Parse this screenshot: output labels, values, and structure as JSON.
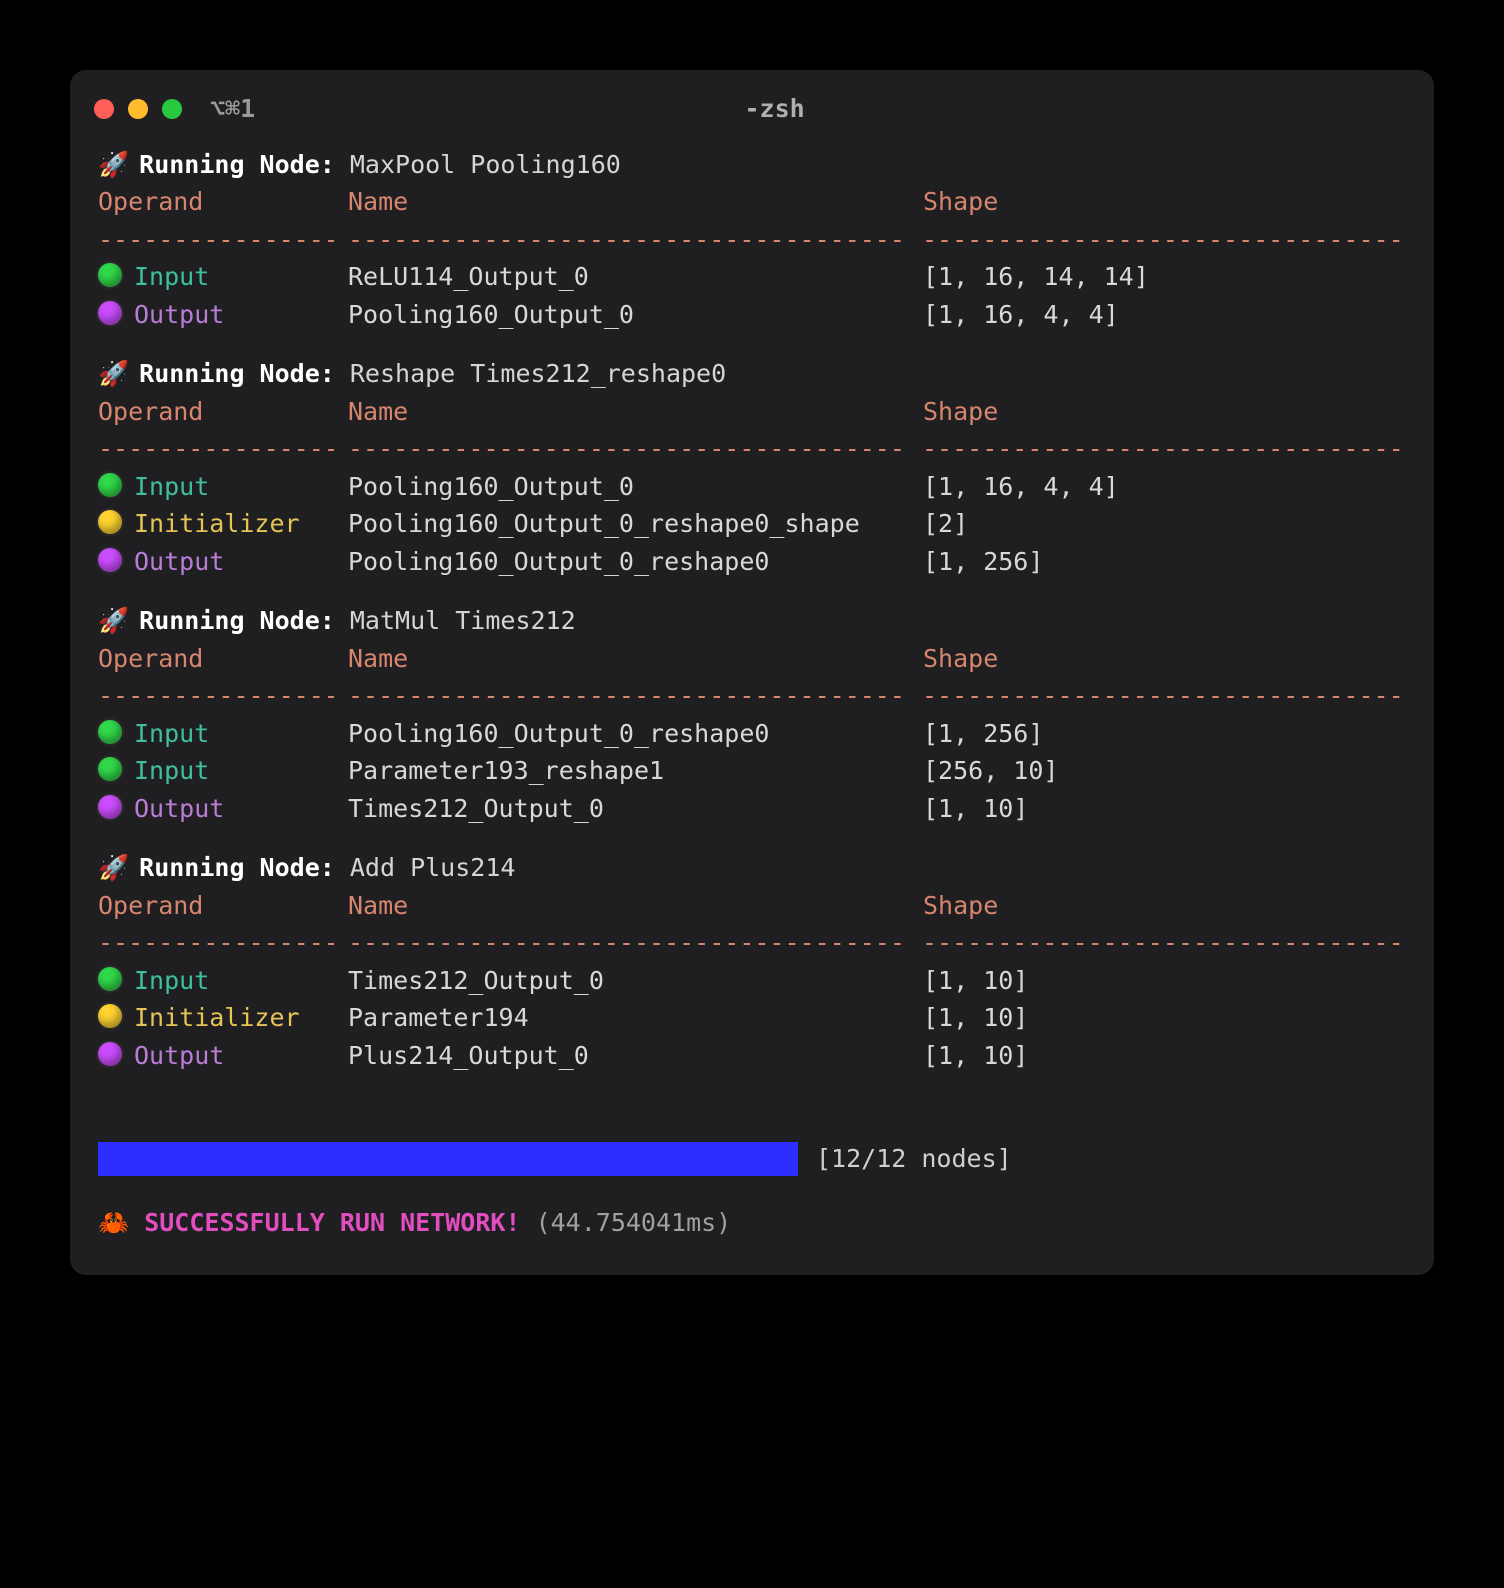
{
  "window": {
    "tab_label": "⌥⌘1",
    "title": "-zsh"
  },
  "headers": {
    "operand": "Operand",
    "name": "Name",
    "shape": "Shape"
  },
  "running_label": "Running Node:",
  "nodes": [
    {
      "title": "MaxPool Pooling160",
      "rows": [
        {
          "kind": "Input",
          "name": "ReLU114_Output_0",
          "shape": "[1, 16, 14, 14]"
        },
        {
          "kind": "Output",
          "name": "Pooling160_Output_0",
          "shape": "[1, 16, 4, 4]"
        }
      ]
    },
    {
      "title": "Reshape Times212_reshape0",
      "rows": [
        {
          "kind": "Input",
          "name": "Pooling160_Output_0",
          "shape": "[1, 16, 4, 4]"
        },
        {
          "kind": "Initializer",
          "name": "Pooling160_Output_0_reshape0_shape",
          "shape": "[2]"
        },
        {
          "kind": "Output",
          "name": "Pooling160_Output_0_reshape0",
          "shape": "[1, 256]"
        }
      ]
    },
    {
      "title": "MatMul Times212",
      "rows": [
        {
          "kind": "Input",
          "name": "Pooling160_Output_0_reshape0",
          "shape": "[1, 256]"
        },
        {
          "kind": "Input",
          "name": "Parameter193_reshape1",
          "shape": "[256, 10]"
        },
        {
          "kind": "Output",
          "name": "Times212_Output_0",
          "shape": "[1, 10]"
        }
      ]
    },
    {
      "title": "Add Plus214",
      "rows": [
        {
          "kind": "Input",
          "name": "Times212_Output_0",
          "shape": "[1, 10]"
        },
        {
          "kind": "Initializer",
          "name": "Parameter194",
          "shape": "[1, 10]"
        },
        {
          "kind": "Output",
          "name": "Plus214_Output_0",
          "shape": "[1, 10]"
        }
      ]
    }
  ],
  "progress": {
    "label": "[12/12 nodes]"
  },
  "success": {
    "emoji": "🦀",
    "message": "SUCCESSFULLY RUN NETWORK!",
    "timing": "(44.754041ms)"
  }
}
